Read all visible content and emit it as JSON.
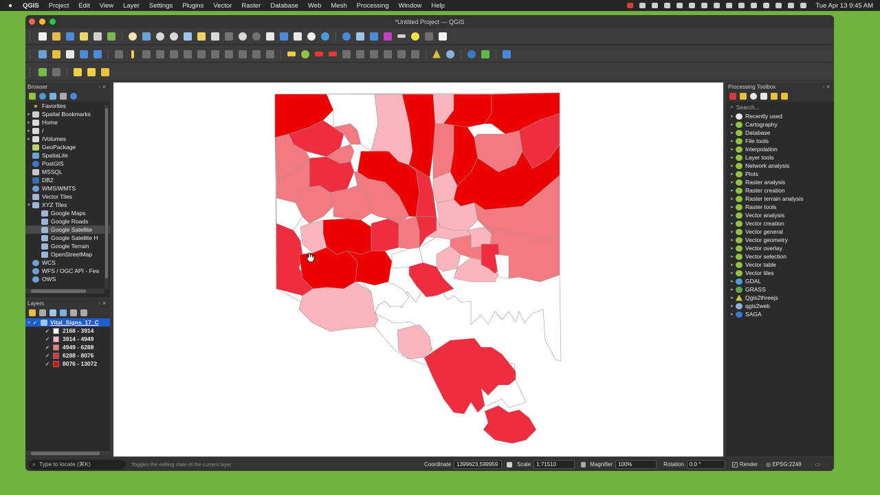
{
  "macos": {
    "menu": [
      "QGIS",
      "Project",
      "Edit",
      "View",
      "Layer",
      "Settings",
      "Plugins",
      "Vector",
      "Raster",
      "Database",
      "Web",
      "Mesh",
      "Processing",
      "Window",
      "Help"
    ],
    "clock": "Tue Apr 13  9:45 AM"
  },
  "window": {
    "title": "*Untitled Project — QGIS"
  },
  "browser": {
    "title": "Browser",
    "items": [
      {
        "label": "Favorites",
        "icon": "star-icon",
        "color": "#f2c413",
        "depth": 0,
        "arrow": ""
      },
      {
        "label": "Spatial Bookmarks",
        "icon": "bookmark-icon",
        "color": "#cfcfcf",
        "depth": 0,
        "arrow": "▸"
      },
      {
        "label": "Home",
        "icon": "folder-icon",
        "color": "#d9d9d9",
        "depth": 0,
        "arrow": "▸"
      },
      {
        "label": "/",
        "icon": "folder-icon",
        "color": "#d9d9d9",
        "depth": 0,
        "arrow": "▸"
      },
      {
        "label": "/Volumes",
        "icon": "folder-icon",
        "color": "#d9d9d9",
        "depth": 0,
        "arrow": "▸"
      },
      {
        "label": "GeoPackage",
        "icon": "geopackage-icon",
        "color": "#b8d46a",
        "depth": 0,
        "arrow": ""
      },
      {
        "label": "SpatiaLite",
        "icon": "spatialite-icon",
        "color": "#6aa2d8",
        "depth": 0,
        "arrow": ""
      },
      {
        "label": "PostGIS",
        "icon": "postgis-icon",
        "color": "#3d77c9",
        "depth": 0,
        "arrow": ""
      },
      {
        "label": "MSSQL",
        "icon": "mssql-icon",
        "color": "#c5c5c5",
        "depth": 0,
        "arrow": ""
      },
      {
        "label": "DB2",
        "icon": "db2-icon",
        "color": "#3b6fb5",
        "depth": 0,
        "arrow": ""
      },
      {
        "label": "WMS/WMTS",
        "icon": "globe-icon",
        "color": "#6aa2d8",
        "depth": 0,
        "arrow": ""
      },
      {
        "label": "Vector Tiles",
        "icon": "grid-icon",
        "color": "#9db5d6",
        "depth": 0,
        "arrow": ""
      },
      {
        "label": "XYZ Tiles",
        "icon": "grid-icon",
        "color": "#9db5d6",
        "depth": 0,
        "arrow": "▾"
      },
      {
        "label": "Google Maps",
        "icon": "grid-icon",
        "color": "#9db5d6",
        "depth": 1,
        "arrow": ""
      },
      {
        "label": "Google Roads",
        "icon": "grid-icon",
        "color": "#9db5d6",
        "depth": 1,
        "arrow": ""
      },
      {
        "label": "Google Satellite",
        "icon": "grid-icon",
        "color": "#9db5d6",
        "depth": 1,
        "arrow": "",
        "selected": true
      },
      {
        "label": "Google Satellite H",
        "icon": "grid-icon",
        "color": "#9db5d6",
        "depth": 1,
        "arrow": ""
      },
      {
        "label": "Google Terrain",
        "icon": "grid-icon",
        "color": "#9db5d6",
        "depth": 1,
        "arrow": ""
      },
      {
        "label": "OpenStreetMap",
        "icon": "grid-icon",
        "color": "#9db5d6",
        "depth": 1,
        "arrow": ""
      },
      {
        "label": "WCS",
        "icon": "globe-icon",
        "color": "#6aa2d8",
        "depth": 0,
        "arrow": ""
      },
      {
        "label": "WFS / OGC API - Fea",
        "icon": "globe-icon",
        "color": "#6aa2d8",
        "depth": 0,
        "arrow": ""
      },
      {
        "label": "OWS",
        "icon": "globe-icon",
        "color": "#6aa2d8",
        "depth": 0,
        "arrow": ""
      }
    ]
  },
  "layers": {
    "title": "Layers",
    "layer_name": "Vital_Signs_17_C",
    "classes": [
      {
        "label": "2168 - 3914",
        "color": "#ffffff"
      },
      {
        "label": "3914 - 4949",
        "color": "#fbb6bd"
      },
      {
        "label": "4949 - 6288",
        "color": "#f47a82"
      },
      {
        "label": "6288 - 8076",
        "color": "#ee2d3f"
      },
      {
        "label": "8076 - 13072",
        "color": "#ee0000"
      }
    ]
  },
  "processing": {
    "title": "Processing Toolbox",
    "search_placeholder": "Search...",
    "items": [
      {
        "label": "Recently used",
        "icon": "clock-icon",
        "color": "#e8e8e8"
      },
      {
        "label": "Cartography",
        "icon": "qgis-icon",
        "color": "#8fc442"
      },
      {
        "label": "Database",
        "icon": "qgis-icon",
        "color": "#8fc442"
      },
      {
        "label": "File tools",
        "icon": "qgis-icon",
        "color": "#8fc442"
      },
      {
        "label": "Interpolation",
        "icon": "qgis-icon",
        "color": "#8fc442"
      },
      {
        "label": "Layer tools",
        "icon": "qgis-icon",
        "color": "#8fc442"
      },
      {
        "label": "Network analysis",
        "icon": "qgis-icon",
        "color": "#8fc442"
      },
      {
        "label": "Plots",
        "icon": "qgis-icon",
        "color": "#8fc442"
      },
      {
        "label": "Raster analysis",
        "icon": "qgis-icon",
        "color": "#8fc442"
      },
      {
        "label": "Raster creation",
        "icon": "qgis-icon",
        "color": "#8fc442"
      },
      {
        "label": "Raster terrain analysis",
        "icon": "qgis-icon",
        "color": "#8fc442"
      },
      {
        "label": "Raster tools",
        "icon": "qgis-icon",
        "color": "#8fc442"
      },
      {
        "label": "Vector analysis",
        "icon": "qgis-icon",
        "color": "#8fc442"
      },
      {
        "label": "Vector creation",
        "icon": "qgis-icon",
        "color": "#8fc442"
      },
      {
        "label": "Vector general",
        "icon": "qgis-icon",
        "color": "#8fc442"
      },
      {
        "label": "Vector geometry",
        "icon": "qgis-icon",
        "color": "#8fc442"
      },
      {
        "label": "Vector overlay",
        "icon": "qgis-icon",
        "color": "#8fc442"
      },
      {
        "label": "Vector selection",
        "icon": "qgis-icon",
        "color": "#8fc442"
      },
      {
        "label": "Vector table",
        "icon": "qgis-icon",
        "color": "#8fc442"
      },
      {
        "label": "Vector tiles",
        "icon": "qgis-icon",
        "color": "#8fc442"
      },
      {
        "label": "GDAL",
        "icon": "gdal-icon",
        "color": "#4aa0d8"
      },
      {
        "label": "GRASS",
        "icon": "grass-icon",
        "color": "#5fa84a"
      },
      {
        "label": "Qgis2threejs",
        "icon": "triangle-icon",
        "color": "#d8c13a"
      },
      {
        "label": "qgis2web",
        "icon": "gear-icon",
        "color": "#8ab0e0"
      },
      {
        "label": "SAGA",
        "icon": "saga-icon",
        "color": "#3c78c8"
      }
    ]
  },
  "status": {
    "locate_placeholder": "Type to locate (⌘K)",
    "message": "Toggles the editing state of the current layer",
    "coordinate_label": "Coordinate",
    "coordinate_value": "1399623,599959",
    "scale_label": "Scale",
    "scale_value": "1:71510",
    "magnifier_label": "Magnifier",
    "magnifier_value": "100%",
    "rotation_label": "Rotation",
    "rotation_value": "0.0 °",
    "render_label": "Render",
    "epsg": "EPSG:2248"
  },
  "colors": {
    "class_1": "#ffffff",
    "class_2": "#fbb6bd",
    "class_3": "#f47a82",
    "class_4": "#ee2d3f",
    "class_5": "#ee0000",
    "selection_blue": "#1f5ccf"
  }
}
